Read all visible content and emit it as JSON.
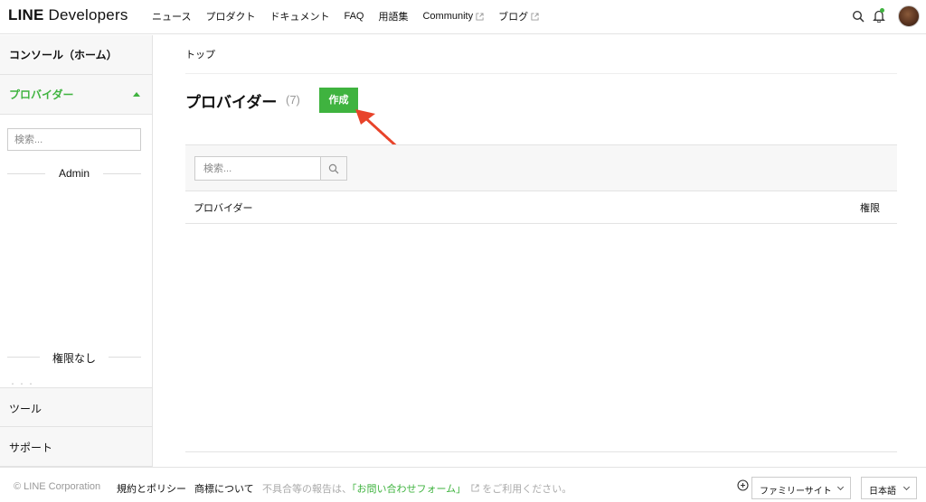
{
  "header": {
    "logo_bold": "LINE",
    "logo_rest": "Developers",
    "nav": [
      {
        "label": "ニュース"
      },
      {
        "label": "プロダクト"
      },
      {
        "label": "ドキュメント"
      },
      {
        "label": "FAQ"
      },
      {
        "label": "用語集"
      },
      {
        "label": "Community"
      },
      {
        "label": "ブログ"
      }
    ]
  },
  "sidebar": {
    "home": "コンソール（ホーム）",
    "providers": "プロバイダー",
    "search_placeholder": "検索...",
    "admin_label": "Admin",
    "no_perm_label": "権限なし",
    "faint_text": "・・・",
    "tools": "ツール",
    "support": "サポート"
  },
  "main": {
    "breadcrumb": "トップ",
    "title": "プロバイダー",
    "count": "(7)",
    "create_label": "作成",
    "search_placeholder": "検索...",
    "col_provider": "プロバイダー",
    "col_permission": "権限"
  },
  "footer": {
    "copyright": "© LINE Corporation",
    "terms": "規約とポリシー",
    "trademark": "商標について",
    "report_prefix": "不具合等の報告は、",
    "report_link": "「お問い合わせフォーム」",
    "report_suffix": "をご利用ください。",
    "family_site": "ファミリーサイト",
    "language": "日本語"
  },
  "colors": {
    "accent": "#3fb33f",
    "annotation_arrow": "#e8432a"
  }
}
